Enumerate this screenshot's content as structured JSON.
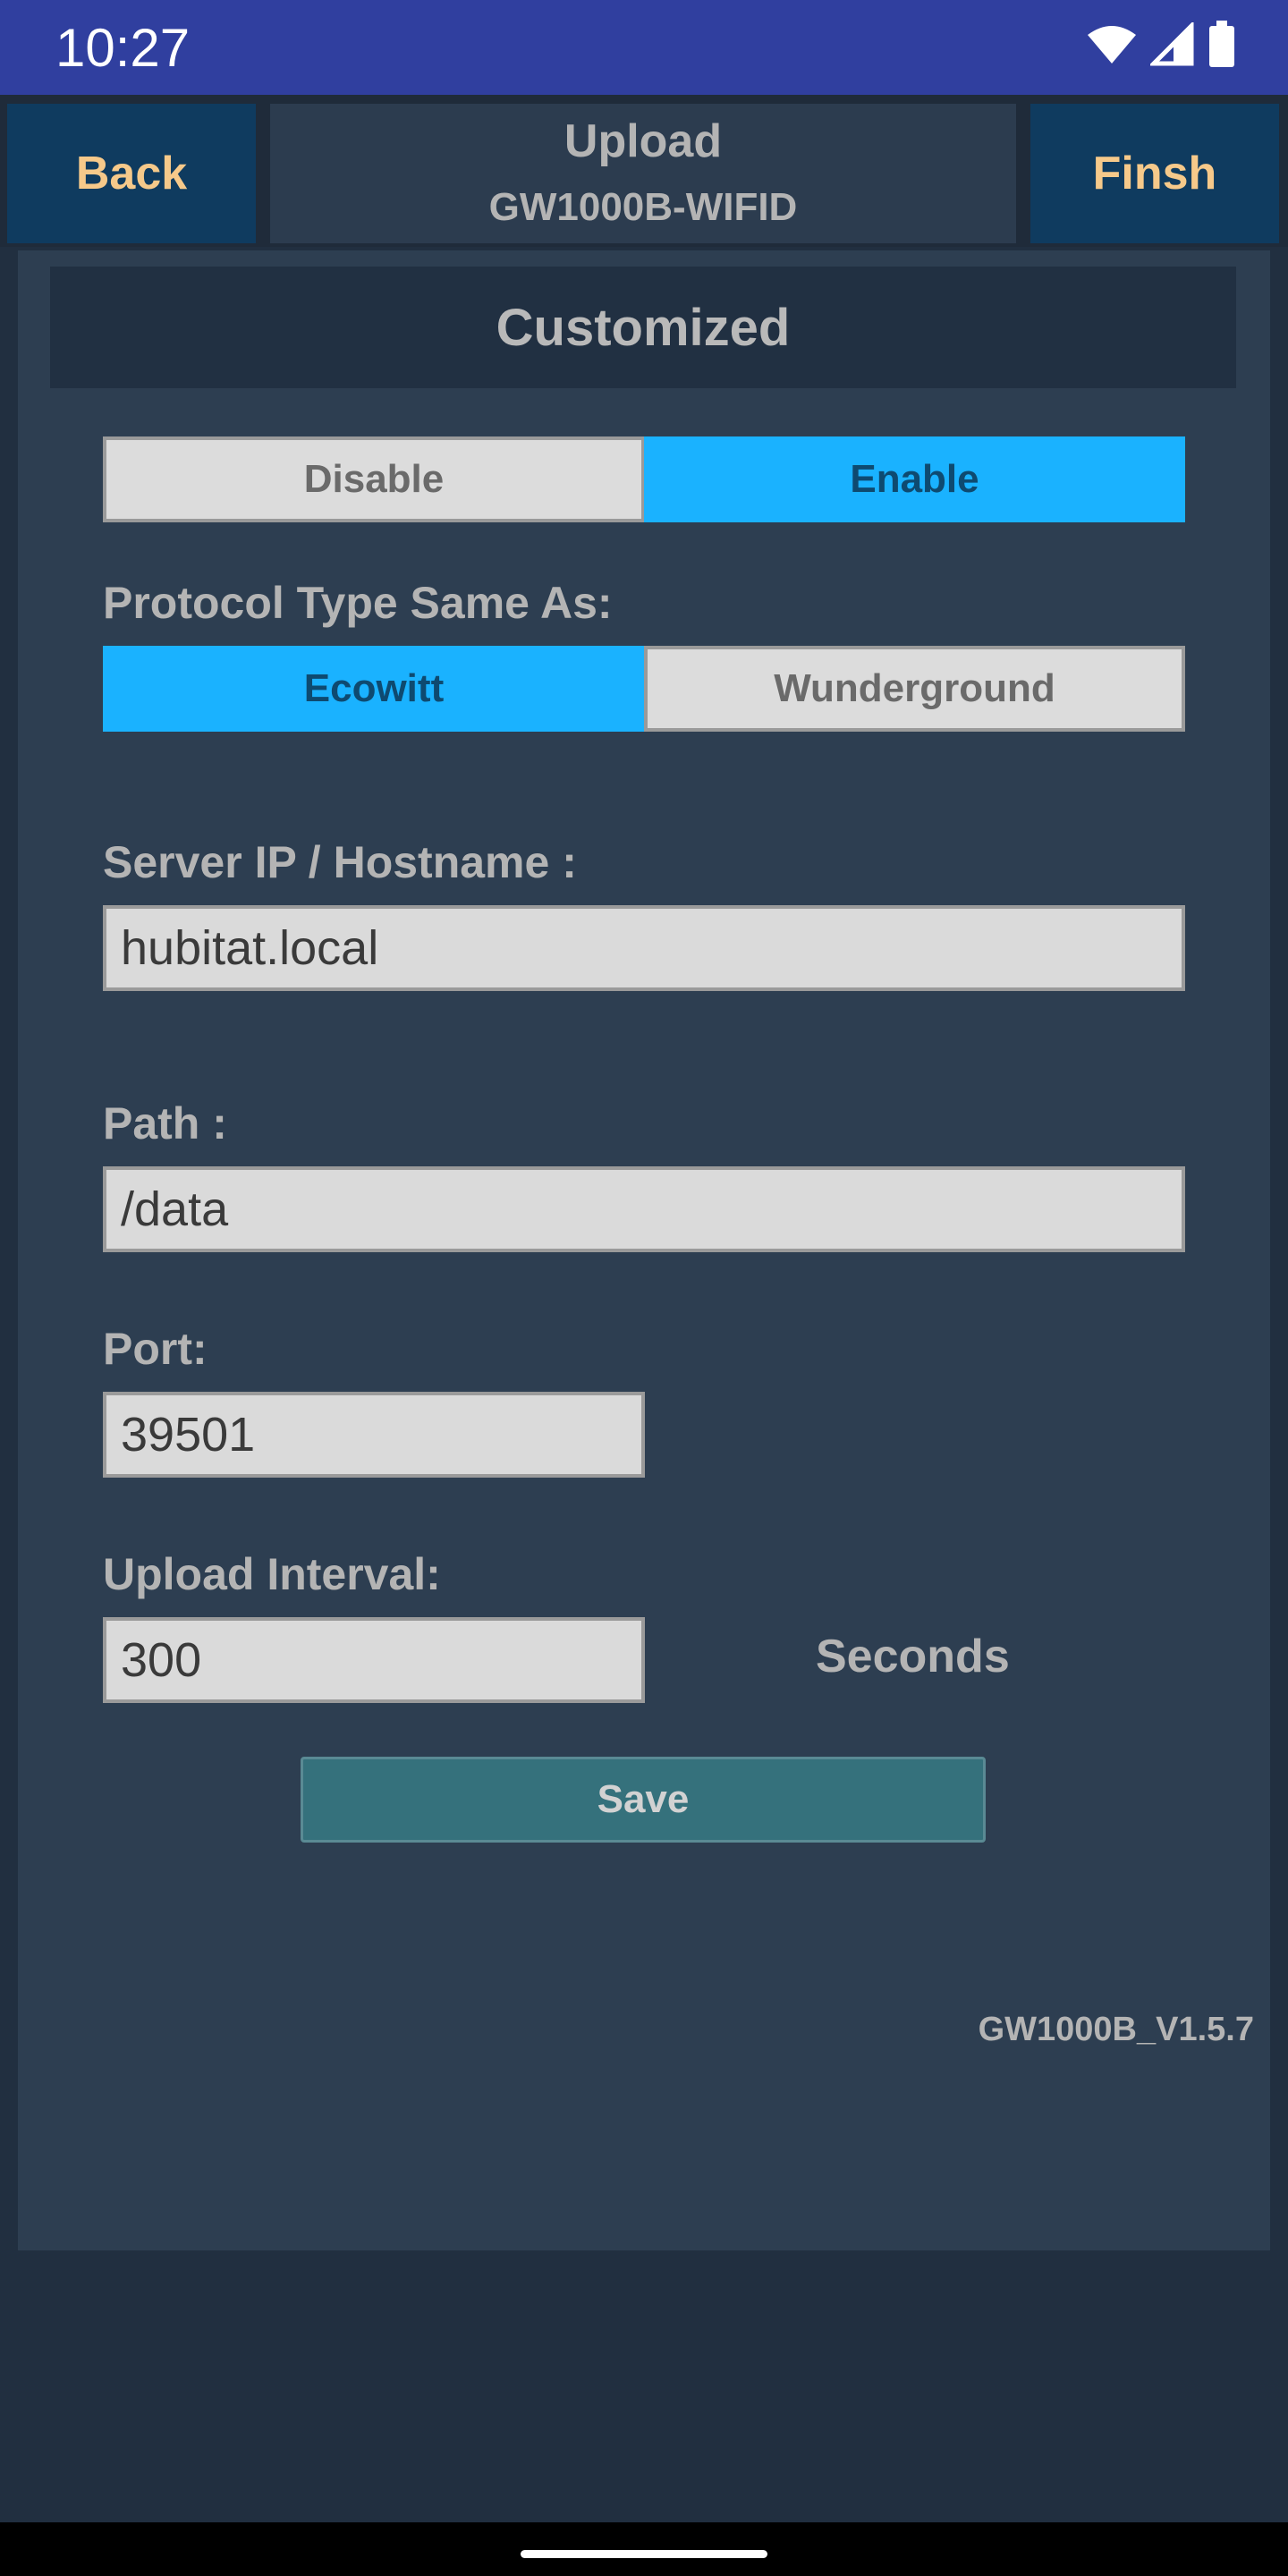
{
  "status_bar": {
    "time": "10:27",
    "icons": [
      "wifi-icon",
      "signal-icon",
      "battery-icon"
    ]
  },
  "header": {
    "back_label": "Back",
    "title_line1": "Upload",
    "title_line2": "GW1000B-WIFID",
    "finish_label": "Finsh"
  },
  "section": {
    "title": "Customized"
  },
  "toggle": {
    "disable_label": "Disable",
    "enable_label": "Enable",
    "selected": "Enable"
  },
  "protocol": {
    "label": "Protocol Type Same As:",
    "option_ecowitt": "Ecowitt",
    "option_wunderground": "Wunderground",
    "selected": "Ecowitt"
  },
  "server": {
    "label": "Server IP / Hostname :",
    "value": "hubitat.local"
  },
  "path": {
    "label": "Path :",
    "value": "/data"
  },
  "port": {
    "label": "Port:",
    "value": "39501"
  },
  "interval": {
    "label": "Upload Interval:",
    "value": "300",
    "unit": "Seconds"
  },
  "save_label": "Save",
  "version": "GW1000B_V1.5.7",
  "colors": {
    "status_bar": "#303f9f",
    "accent_selected": "#1ab2ff",
    "header_button_text": "#f6c98a",
    "save_button": "#35717c"
  }
}
